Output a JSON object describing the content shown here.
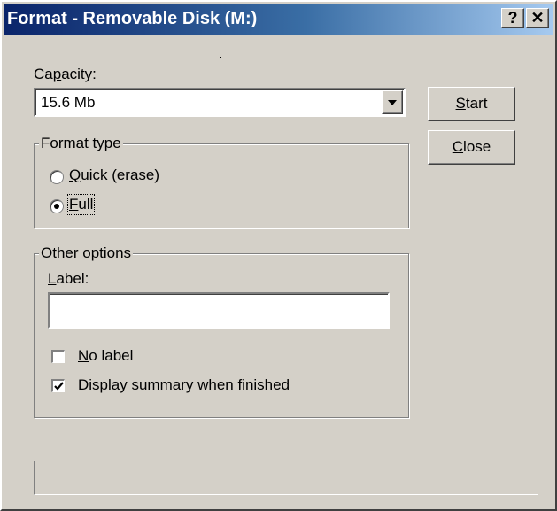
{
  "window": {
    "title": "Format - Removable Disk (M:)",
    "help_label": "?",
    "close_label": "✕"
  },
  "capacity": {
    "label_pre": "Ca",
    "label_ul": "p",
    "label_post": "acity:",
    "value": "15.6 Mb"
  },
  "buttons": {
    "start_ul": "S",
    "start_rest": "tart",
    "close_ul": "C",
    "close_rest": "lose"
  },
  "format_type": {
    "title": "Format type",
    "quick_ul": "Q",
    "quick_rest": "uick (erase)",
    "full_ul": "F",
    "full_rest": "ull",
    "selected": "full"
  },
  "other_options": {
    "title": "Other options",
    "label_ul": "L",
    "label_rest": "abel:",
    "label_value": "",
    "no_label_ul": "N",
    "no_label_rest": "o label",
    "no_label_checked": false,
    "summary_ul": "D",
    "summary_rest": "isplay summary when finished",
    "summary_checked": true
  },
  "progress": {
    "value": 0
  },
  "colors": {
    "face": "#d4d0c8",
    "title_start": "#0a246a",
    "title_end": "#a6caf0"
  }
}
